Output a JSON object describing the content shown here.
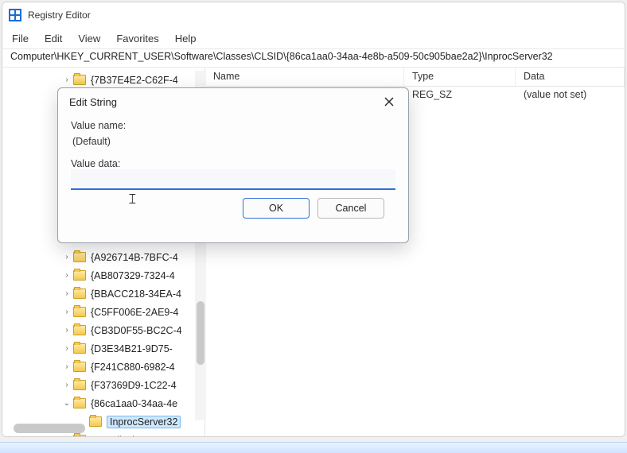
{
  "window": {
    "title": "Registry Editor"
  },
  "menu": {
    "file": "File",
    "edit": "Edit",
    "view": "View",
    "favorites": "Favorites",
    "help": "Help"
  },
  "addressbar": "Computer\\HKEY_CURRENT_USER\\Software\\Classes\\CLSID\\{86ca1aa0-34aa-4e8b-a509-50c905bae2a2}\\InprocServer32",
  "tree": {
    "items": [
      {
        "label": "{7B37E4E2-C62F-4",
        "expand": "›",
        "level": 1
      },
      {
        "label": "{A926714B-7BFC-4",
        "expand": "›",
        "level": 1
      },
      {
        "label": "{AB807329-7324-4",
        "expand": "›",
        "level": 1
      },
      {
        "label": "{BBACC218-34EA-4",
        "expand": "›",
        "level": 1
      },
      {
        "label": "{C5FF006E-2AE9-4",
        "expand": "›",
        "level": 1
      },
      {
        "label": "{CB3D0F55-BC2C-4",
        "expand": "›",
        "level": 1
      },
      {
        "label": "{D3E34B21-9D75-",
        "expand": "›",
        "level": 1
      },
      {
        "label": "{F241C880-6982-4",
        "expand": "›",
        "level": 1
      },
      {
        "label": "{F37369D9-1C22-4",
        "expand": "›",
        "level": 1
      },
      {
        "label": "{86ca1aa0-34aa-4e",
        "expand": "⌄",
        "level": 1
      },
      {
        "label": "InprocServer32",
        "expand": "",
        "level": 2,
        "selected": true
      },
      {
        "label": "com.clipchamp.app",
        "expand": "",
        "level": 1
      }
    ]
  },
  "list": {
    "headers": {
      "name": "Name",
      "type": "Type",
      "data": "Data"
    },
    "rows": [
      {
        "name": "",
        "type": "REG_SZ",
        "data": "(value not set)"
      }
    ]
  },
  "dialog": {
    "title": "Edit String",
    "value_name_label": "Value name:",
    "value_name": "(Default)",
    "value_data_label": "Value data:",
    "value_data": "",
    "ok": "OK",
    "cancel": "Cancel"
  }
}
